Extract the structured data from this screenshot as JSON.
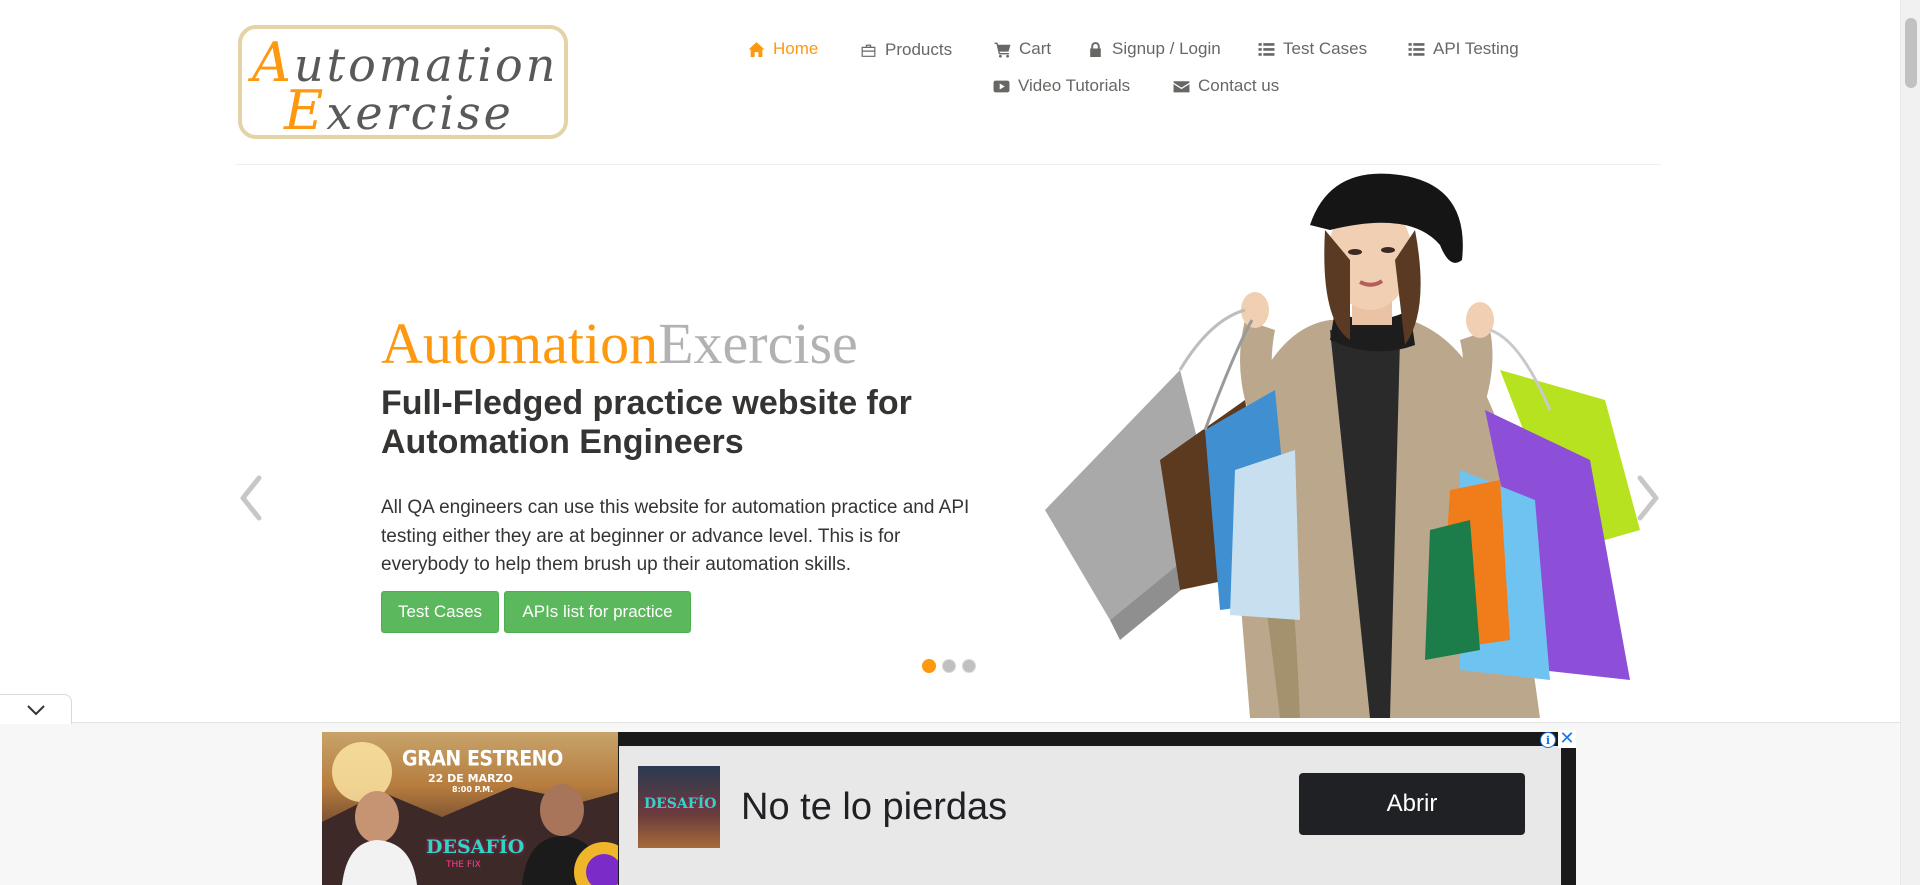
{
  "logo": {
    "line1_cap": "A",
    "line1_rest": "utomation",
    "line2_cap": "E",
    "line2_rest": "xercise"
  },
  "nav": [
    {
      "label": "Home",
      "icon": "home-icon",
      "active": true
    },
    {
      "label": "Products",
      "icon": "briefcase-icon",
      "active": false
    },
    {
      "label": "Cart",
      "icon": "shopping-cart-icon",
      "active": false
    },
    {
      "label": "Signup / Login",
      "icon": "lock-icon",
      "active": false
    },
    {
      "label": "Test Cases",
      "icon": "list-icon",
      "active": false
    },
    {
      "label": "API Testing",
      "icon": "list-icon",
      "active": false
    },
    {
      "label": "Video Tutorials",
      "icon": "youtube-play-icon",
      "active": false
    },
    {
      "label": "Contact us",
      "icon": "envelope-icon",
      "active": false
    }
  ],
  "slider": {
    "brand_orange": "Automation",
    "brand_grey": "Exercise",
    "heading": "Full-Fledged practice website for Automation Engineers",
    "text": "All QA engineers can use this website for automation practice and API testing either they are at beginner or advance level. This is for everybody to help them brush up their automation skills.",
    "buttons": [
      "Test Cases",
      "APIs list for practice"
    ],
    "active_slide": 1,
    "slide_count": 3
  },
  "ad": {
    "poster_title": "GRAN ESTRENO",
    "poster_date": "22 DE MARZO",
    "poster_time": "8:00 P.M.",
    "poster_logo": "DESAFÍO",
    "poster_sub": "THE FIX",
    "headline": "No te lo pierdas",
    "cta": "Abrir",
    "info_glyph": "i",
    "close_glyph": "✕"
  },
  "colors": {
    "accent": "#fe980f",
    "button_green": "#5cb85c",
    "text_dark": "#363432",
    "text_muted": "#696763"
  }
}
